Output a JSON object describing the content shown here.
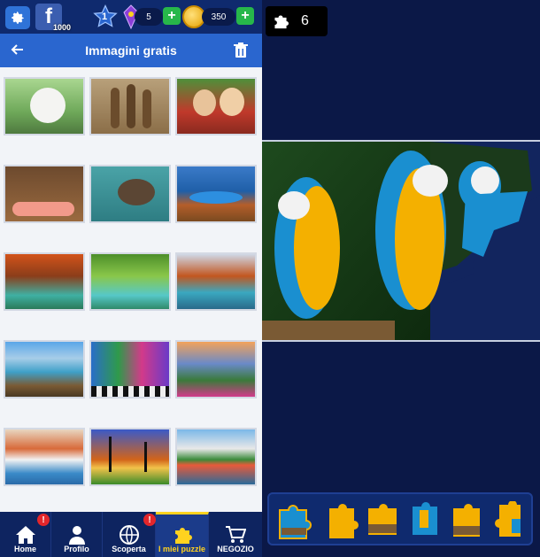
{
  "header": {
    "fb_badge": "1000",
    "level": "1",
    "gems": "5",
    "coins": "350",
    "plus_symbol": "+"
  },
  "subheader": {
    "title": "Immagini gratis"
  },
  "gallery": {
    "items": [
      "puppy",
      "meerkats",
      "pomeranians",
      "dachshund-cat",
      "otter",
      "mountain-lake",
      "waterfall-autumn",
      "waterfall-green",
      "lake-forest",
      "lake-pier",
      "colorful-houses",
      "flower-valley",
      "coastal-village",
      "palm-sunset",
      "harbor-town"
    ]
  },
  "nav": {
    "home": "Home",
    "profile": "Profilo",
    "discover": "Scoperta",
    "my_puzzles": "I miei puzzle",
    "shop": "NEGOZIO",
    "alert_symbol": "!"
  },
  "game": {
    "pieces_remaining": "6"
  },
  "colors": {
    "topbar": "#0f2a6e",
    "subbar": "#2a66cf",
    "accent": "#ffd21f",
    "alert": "#e3262b",
    "plus": "#27b74a"
  }
}
